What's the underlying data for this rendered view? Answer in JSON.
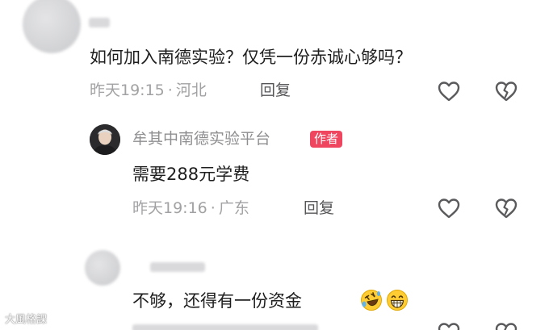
{
  "comments": [
    {
      "text": "如何加入南德实验？仅凭一份赤诚心够吗？",
      "time": "昨天19:15",
      "location": "河北",
      "reply_label": "回复"
    },
    {
      "author": "牟其中南德实验平台",
      "badge": "作者",
      "text": "需要288元学费",
      "time": "昨天19:16",
      "location": "广东",
      "reply_label": "回复"
    },
    {
      "text": "不够，还得有一份资金"
    }
  ],
  "separator": "·",
  "watermark": "大風格課",
  "icons": {
    "like": "heart-outline-icon",
    "dislike": "broken-heart-icon",
    "emoji_1": "rolling-laughing-emoji",
    "emoji_2": "grinning-emoji"
  },
  "colors": {
    "badge": "#f0455f",
    "meta_text": "#a2a2a4",
    "body_text": "#1e1e1e"
  }
}
